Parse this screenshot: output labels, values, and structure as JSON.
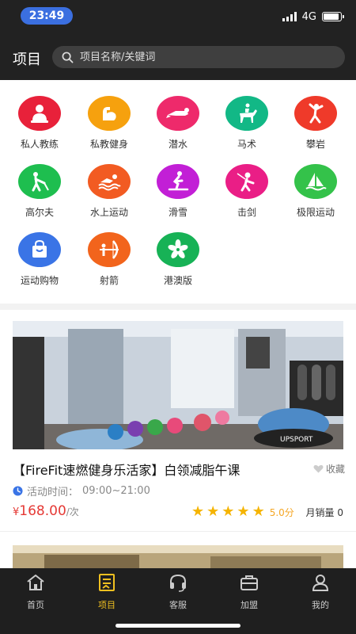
{
  "status_bar": {
    "time": "23:49",
    "network": "4G"
  },
  "header": {
    "title": "项目",
    "search_placeholder": "项目名称/关键词"
  },
  "categories": [
    {
      "label": "私人教练",
      "color": "#e8213a",
      "icon": "coach-icon"
    },
    {
      "label": "私教健身",
      "color": "#f6a10e",
      "icon": "fitness-icon"
    },
    {
      "label": "潜水",
      "color": "#ee2a6b",
      "icon": "diving-icon"
    },
    {
      "label": "马术",
      "color": "#12b886",
      "icon": "equestrian-icon"
    },
    {
      "label": "攀岩",
      "color": "#ef3a2a",
      "icon": "climbing-icon"
    },
    {
      "label": "高尔夫",
      "color": "#1ebe4f",
      "icon": "golf-icon"
    },
    {
      "label": "水上运动",
      "color": "#f25b22",
      "icon": "water-sports-icon"
    },
    {
      "label": "滑雪",
      "color": "#c21fd6",
      "icon": "skiing-icon"
    },
    {
      "label": "击剑",
      "color": "#ea1e86",
      "icon": "fencing-icon"
    },
    {
      "label": "极限运动",
      "color": "#34c24a",
      "icon": "extreme-sports-icon"
    },
    {
      "label": "运动购物",
      "color": "#3a74e6",
      "icon": "shopping-icon"
    },
    {
      "label": "射箭",
      "color": "#f2641c",
      "icon": "archery-icon"
    },
    {
      "label": "港澳版",
      "color": "#17b256",
      "icon": "hk-macao-icon"
    }
  ],
  "card": {
    "title": "【FireFit速燃健身乐活家】白领减脂午课",
    "favorite_label": "收藏",
    "time_label": "活动时间：",
    "time_value": "09:00~21:00",
    "currency": "¥",
    "price": "168.00",
    "unit": "/次",
    "stars": 5,
    "score": "5.0分",
    "sales": "月销量 0",
    "image_text": "UPSPORT"
  },
  "tabbar": {
    "items": [
      {
        "label": "首页",
        "icon": "home-icon"
      },
      {
        "label": "项目",
        "icon": "project-icon"
      },
      {
        "label": "客服",
        "icon": "headset-icon"
      },
      {
        "label": "加盟",
        "icon": "join-icon"
      },
      {
        "label": "我的",
        "icon": "profile-icon"
      }
    ],
    "active_index": 1
  },
  "colors": {
    "accent": "#f0c020",
    "price": "#e53935",
    "star": "#f5b400"
  }
}
